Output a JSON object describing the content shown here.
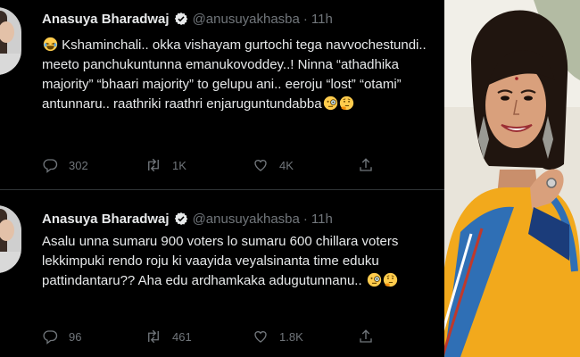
{
  "tweets": [
    {
      "name": "Anasuya Bharadwaj",
      "handle": "@anusuyakhasba",
      "separator": "·",
      "time": "11h",
      "text": "Kshaminchali.. okka vishayam gurtochi tega navvochestundi.. meeto panchukuntunna emanukovoddey..! Ninna “athadhika majority” “bhaari majority” to gelupu ani.. eeroju “lost” “otami” antunnaru.. raathriki raathri enjaruguntundabba",
      "replies": "302",
      "retweets": "1K",
      "likes": "4K"
    },
    {
      "name": "Anasuya Bharadwaj",
      "handle": "@anusuyakhasba",
      "separator": "·",
      "time": "11h",
      "text": "Asalu unna sumaru 900 voters lo sumaru 600 chillara voters lekkimpuki rendo roju ki vaayida veyalsinanta time eduku pattindantaru?? Aha edu ardhamkaka adugutunnanu..",
      "replies": "96",
      "retweets": "461",
      "likes": "1.8K"
    }
  ],
  "colors": {
    "background": "#000000",
    "text": "#e7e9ea",
    "muted": "#71767b",
    "verified": "#1d9bf0",
    "saree": "#f2a91c"
  },
  "icons": [
    "verified-badge-icon",
    "reply-icon",
    "retweet-icon",
    "like-icon",
    "share-icon",
    "laughing-emoji-icon",
    "monocle-emoji-icon",
    "thinking-emoji-icon"
  ]
}
